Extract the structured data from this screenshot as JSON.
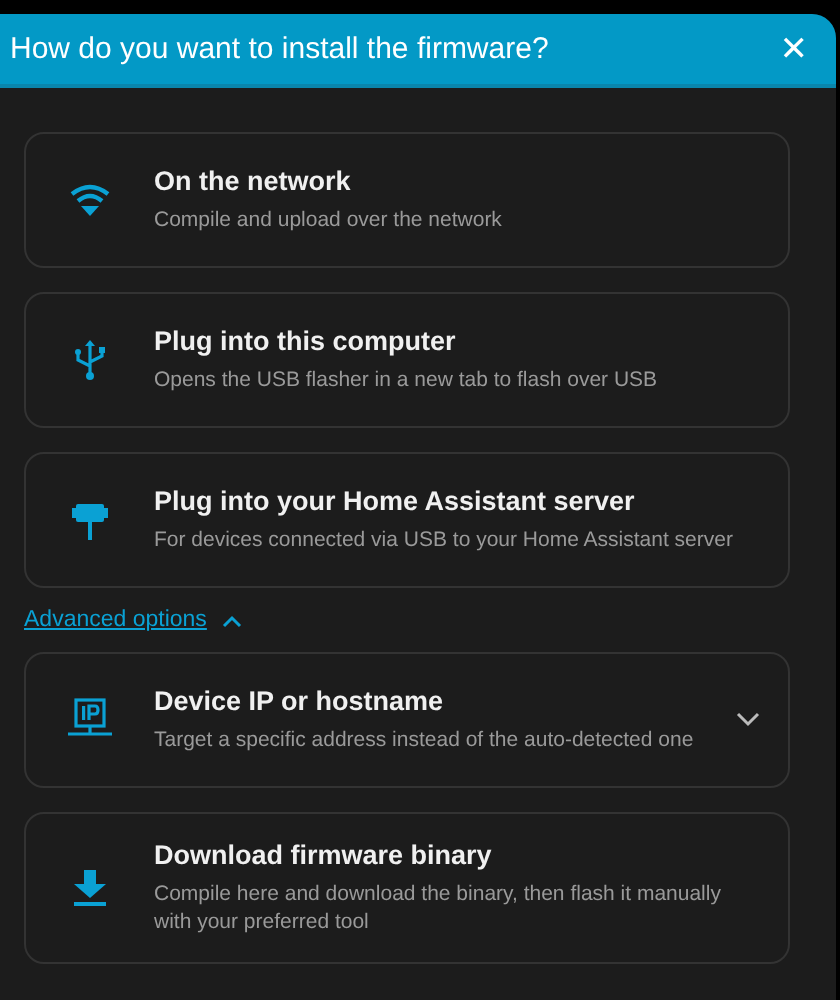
{
  "dialog": {
    "title": "How do you want to install the firmware?",
    "close": "✕"
  },
  "options": [
    {
      "kind": "network",
      "title": "On the network",
      "description": "Compile and upload over the network"
    },
    {
      "kind": "usb",
      "title": "Plug into this computer",
      "description": "Opens the USB flasher in a new tab to flash over USB"
    },
    {
      "kind": "server",
      "title": "Plug into your Home Assistant server",
      "description": "For devices connected via USB to your Home Assistant server"
    }
  ],
  "advanced": {
    "label": "Advanced options",
    "expanded": true,
    "options": [
      {
        "kind": "ip",
        "title": "Device IP or hostname",
        "description": "Target a specific address instead of the auto-detected one",
        "expanded": false
      },
      {
        "kind": "download",
        "title": "Download firmware binary",
        "description": "Compile here and download the binary, then flash it manually with your preferred tool"
      }
    ]
  }
}
